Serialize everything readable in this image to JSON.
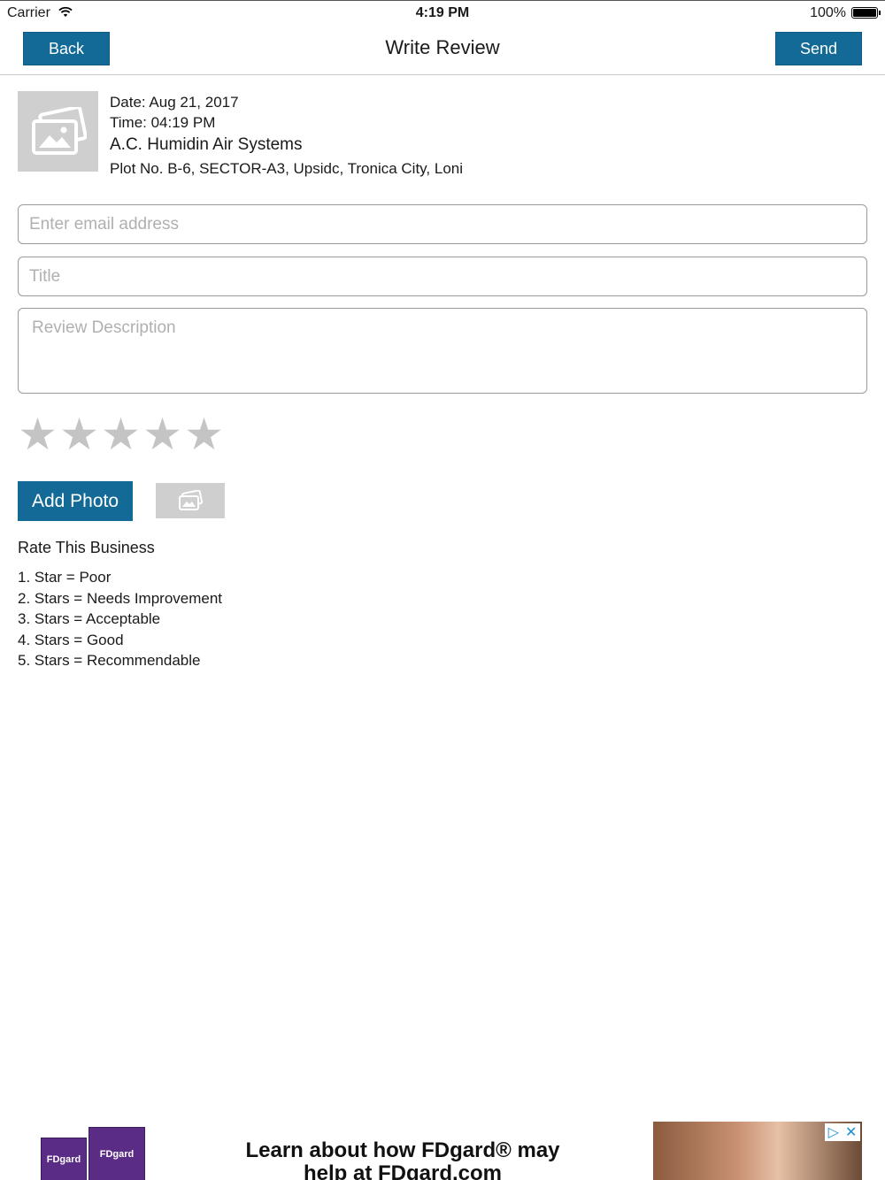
{
  "status_bar": {
    "carrier": "Carrier",
    "time": "4:19 PM",
    "battery": "100%"
  },
  "nav": {
    "back_label": "Back",
    "title": "Write Review",
    "send_label": "Send"
  },
  "business": {
    "date": "Date: Aug 21, 2017",
    "time": "Time: 04:19 PM",
    "name": "A.C. Humidin Air Systems",
    "address": "Plot No. B-6, SECTOR-A3, Upsidc, Tronica City, Loni"
  },
  "form": {
    "email_placeholder": "Enter email address",
    "email_value": "",
    "title_placeholder": "Title",
    "title_value": "",
    "description_placeholder": "Review Description",
    "description_value": "",
    "rating": 0,
    "rating_max": 5,
    "add_photo_label": "Add Photo"
  },
  "rating_guide": {
    "heading": "Rate This Business",
    "items": [
      "1. Star = Poor",
      "2. Stars = Needs Improvement",
      "3. Stars = Acceptable",
      "4. Stars = Good",
      "5. Stars = Recommendable"
    ]
  },
  "ad": {
    "text": "Learn about how FDgard® may help at FDgard.com",
    "product_label": "FDgard"
  },
  "colors": {
    "accent": "#146a96",
    "star_empty": "#c4c4c4",
    "placeholder_gray": "#cfcfcf"
  },
  "icons": {
    "business_image": "image-placeholder-icon",
    "photo_slot": "image-placeholder-icon",
    "star": "star-icon",
    "wifi": "wifi-icon",
    "battery": "battery-icon",
    "ad_choices": "adchoices-icon",
    "ad_close": "close-icon"
  }
}
